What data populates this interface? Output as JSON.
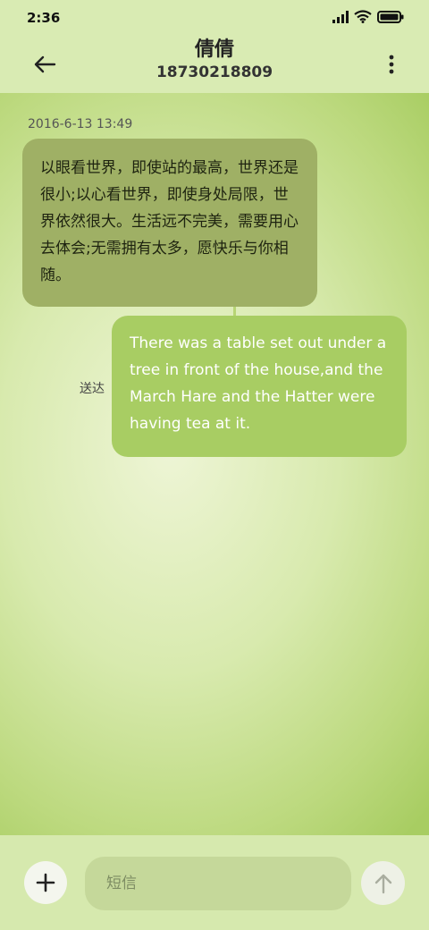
{
  "status_bar": {
    "time": "2:36",
    "icons": [
      "signal-icon",
      "wifi-icon",
      "battery-icon"
    ]
  },
  "header": {
    "contact_name": "倩倩",
    "contact_number": "18730218809",
    "back_icon": "arrow-left-icon",
    "more_icon": "more-vertical-icon"
  },
  "conversation": {
    "timestamp": "2016-6-13 13:49",
    "messages": [
      {
        "direction": "incoming",
        "text": "以眼看世界，即使站的最高，世界还是很小;以心看世界，即使身处局限，世界依然很大。生活远不完美，需要用心去体会;无需拥有太多，愿快乐与你相随。"
      },
      {
        "direction": "outgoing",
        "text": "There was a table set out under a tree in front of the house,and the March Hare and the Hatter were having tea at it.",
        "status": "送达"
      }
    ]
  },
  "composer": {
    "add_icon": "plus-icon",
    "placeholder": "短信",
    "value": "",
    "send_icon": "arrow-up-icon"
  },
  "colors": {
    "incoming_bubble": "#9fb065",
    "outgoing_bubble": "#a8cd63",
    "header_bg": "#d9ebb3"
  }
}
